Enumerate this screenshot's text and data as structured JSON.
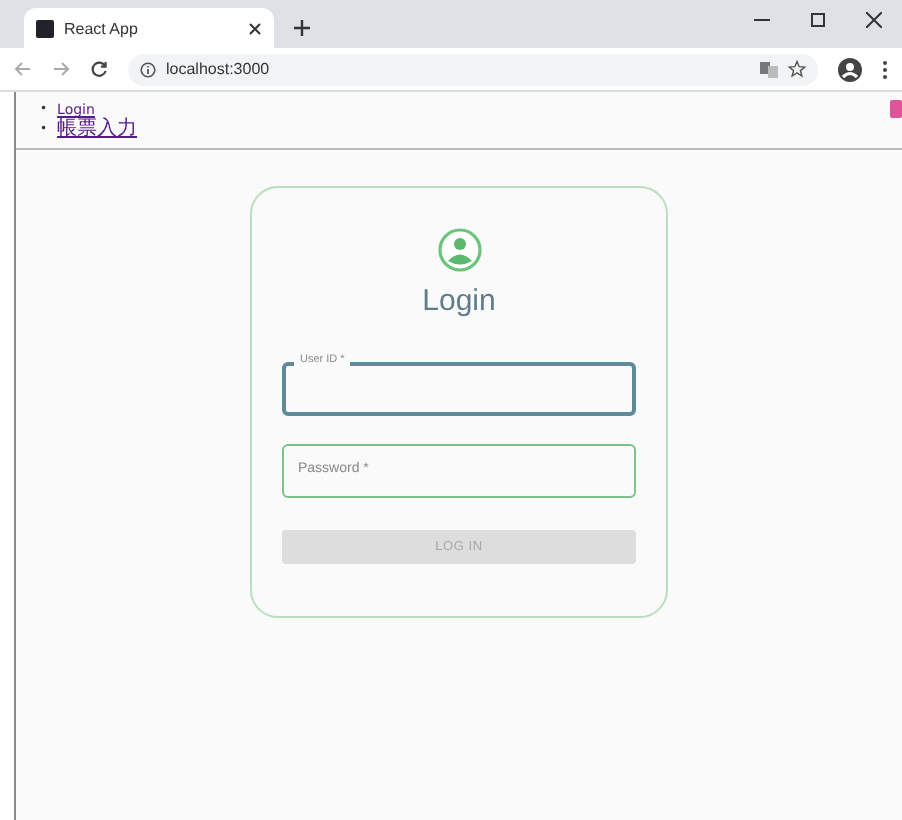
{
  "browser": {
    "tab": {
      "title": "React App"
    },
    "address": "localhost:3000"
  },
  "nav": [
    {
      "bullet": "•",
      "label": "Login"
    },
    {
      "bullet": "•",
      "label": "帳票入力"
    }
  ],
  "login": {
    "title": "Login",
    "fields": [
      {
        "label": "User ID *",
        "focused": true
      },
      {
        "label": "Password *",
        "focused": false
      }
    ],
    "button": {
      "label": "LOG IN",
      "disabled": true
    }
  }
}
